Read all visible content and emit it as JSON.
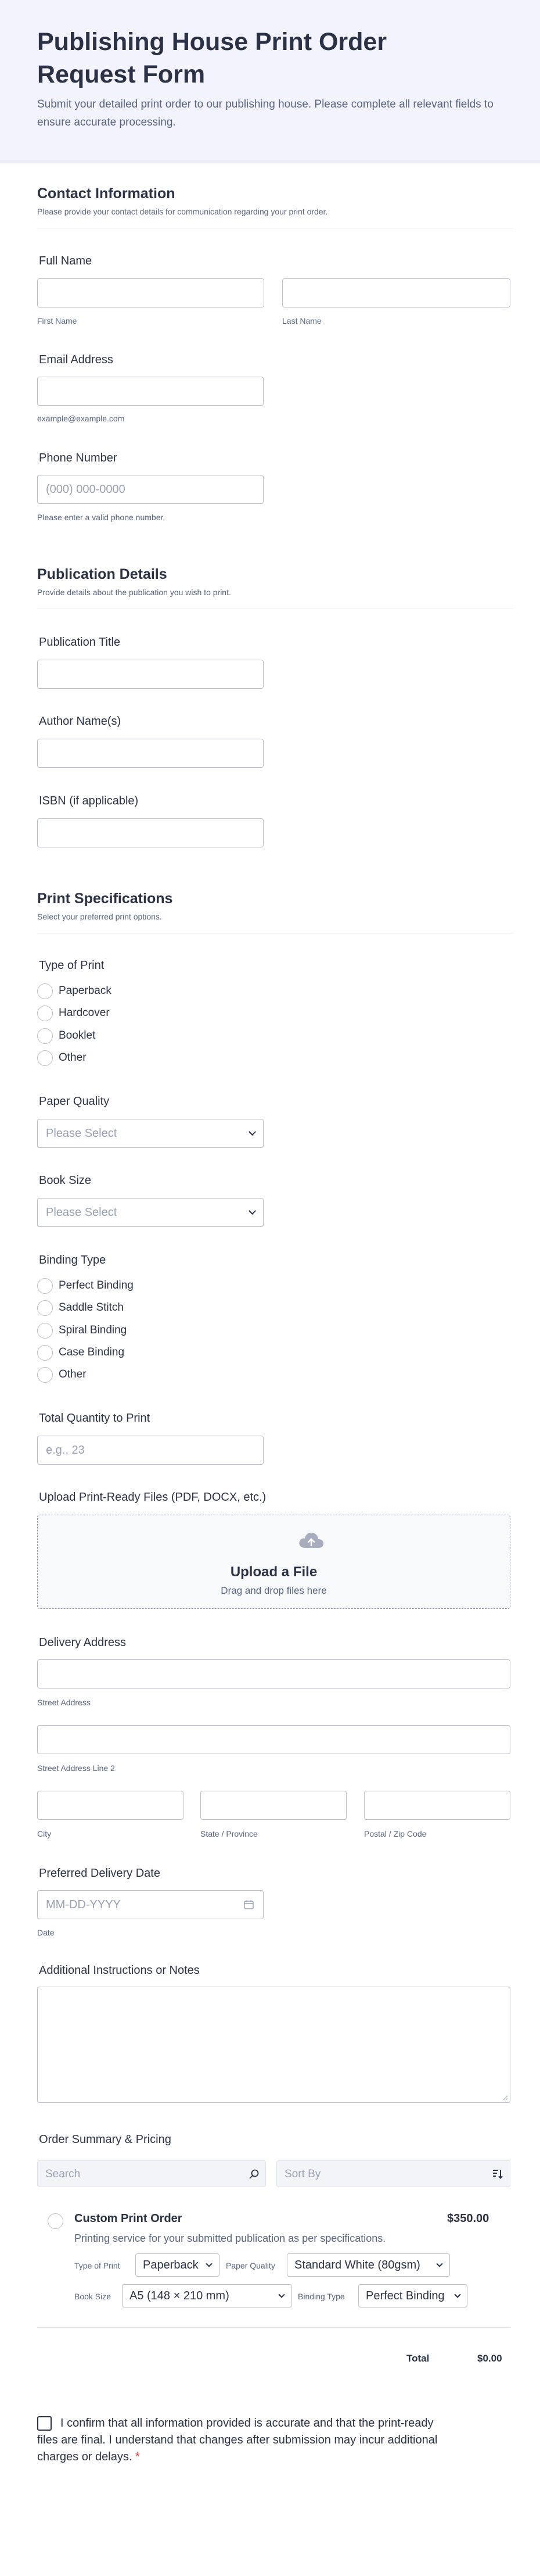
{
  "header": {
    "title": "Publishing House Print Order Request Form",
    "subtitle": "Submit your detailed print order to our publishing house. Please complete all relevant fields to ensure accurate processing."
  },
  "sections": {
    "contact": {
      "title": "Contact Information",
      "desc": "Please provide your contact details for communication regarding your print order."
    },
    "publication": {
      "title": "Publication Details",
      "desc": "Provide details about the publication you wish to print."
    },
    "print": {
      "title": "Print Specifications",
      "desc": "Select your preferred print options."
    }
  },
  "fields": {
    "full_name": {
      "label": "Full Name",
      "first": "First Name",
      "last": "Last Name"
    },
    "email": {
      "label": "Email Address",
      "sub": "example@example.com"
    },
    "phone": {
      "label": "Phone Number",
      "placeholder": "(000) 000-0000",
      "sub": "Please enter a valid phone number."
    },
    "pub_title": {
      "label": "Publication Title"
    },
    "author": {
      "label": "Author Name(s)"
    },
    "isbn": {
      "label": "ISBN (if applicable)"
    },
    "print_type": {
      "label": "Type of Print",
      "options": [
        "Paperback",
        "Hardcover",
        "Booklet",
        "Other"
      ]
    },
    "paper_quality": {
      "label": "Paper Quality",
      "placeholder": "Please Select"
    },
    "book_size": {
      "label": "Book Size",
      "placeholder": "Please Select"
    },
    "binding": {
      "label": "Binding Type",
      "options": [
        "Perfect Binding",
        "Saddle Stitch",
        "Spiral Binding",
        "Case Binding",
        "Other"
      ]
    },
    "quantity": {
      "label": "Total Quantity to Print",
      "placeholder": "e.g., 23"
    },
    "upload": {
      "label": "Upload Print-Ready Files (PDF, DOCX, etc.)",
      "title": "Upload a File",
      "desc": "Drag and drop files here"
    },
    "address": {
      "label": "Delivery Address",
      "street": "Street Address",
      "street2": "Street Address Line 2",
      "city": "City",
      "state": "State / Province",
      "zip": "Postal / Zip Code"
    },
    "date": {
      "label": "Preferred Delivery Date",
      "placeholder": "MM-DD-YYYY",
      "sub": "Date"
    },
    "notes": {
      "label": "Additional Instructions or Notes"
    }
  },
  "order": {
    "label": "Order Summary & Pricing",
    "search_placeholder": "Search",
    "sort_placeholder": "Sort By",
    "product": {
      "title": "Custom Print Order",
      "price": "$350.00",
      "desc": "Printing service for your submitted publication as per specifications.",
      "type_label": "Type of Print",
      "type_value": "Paperback",
      "paper_label": "Paper Quality",
      "paper_value": "Standard White (80gsm)",
      "size_label": "Book Size",
      "size_value": "A5 (148 × 210 mm)",
      "binding_label": "Binding Type",
      "binding_value": "Perfect Binding"
    },
    "total_label": "Total",
    "total_value": "$0.00"
  },
  "consent": {
    "text": "I confirm that all information provided is accurate and that the print-ready files are final. I understand that changes after submission may incur additional charges or delays.",
    "required_mark": "*"
  }
}
